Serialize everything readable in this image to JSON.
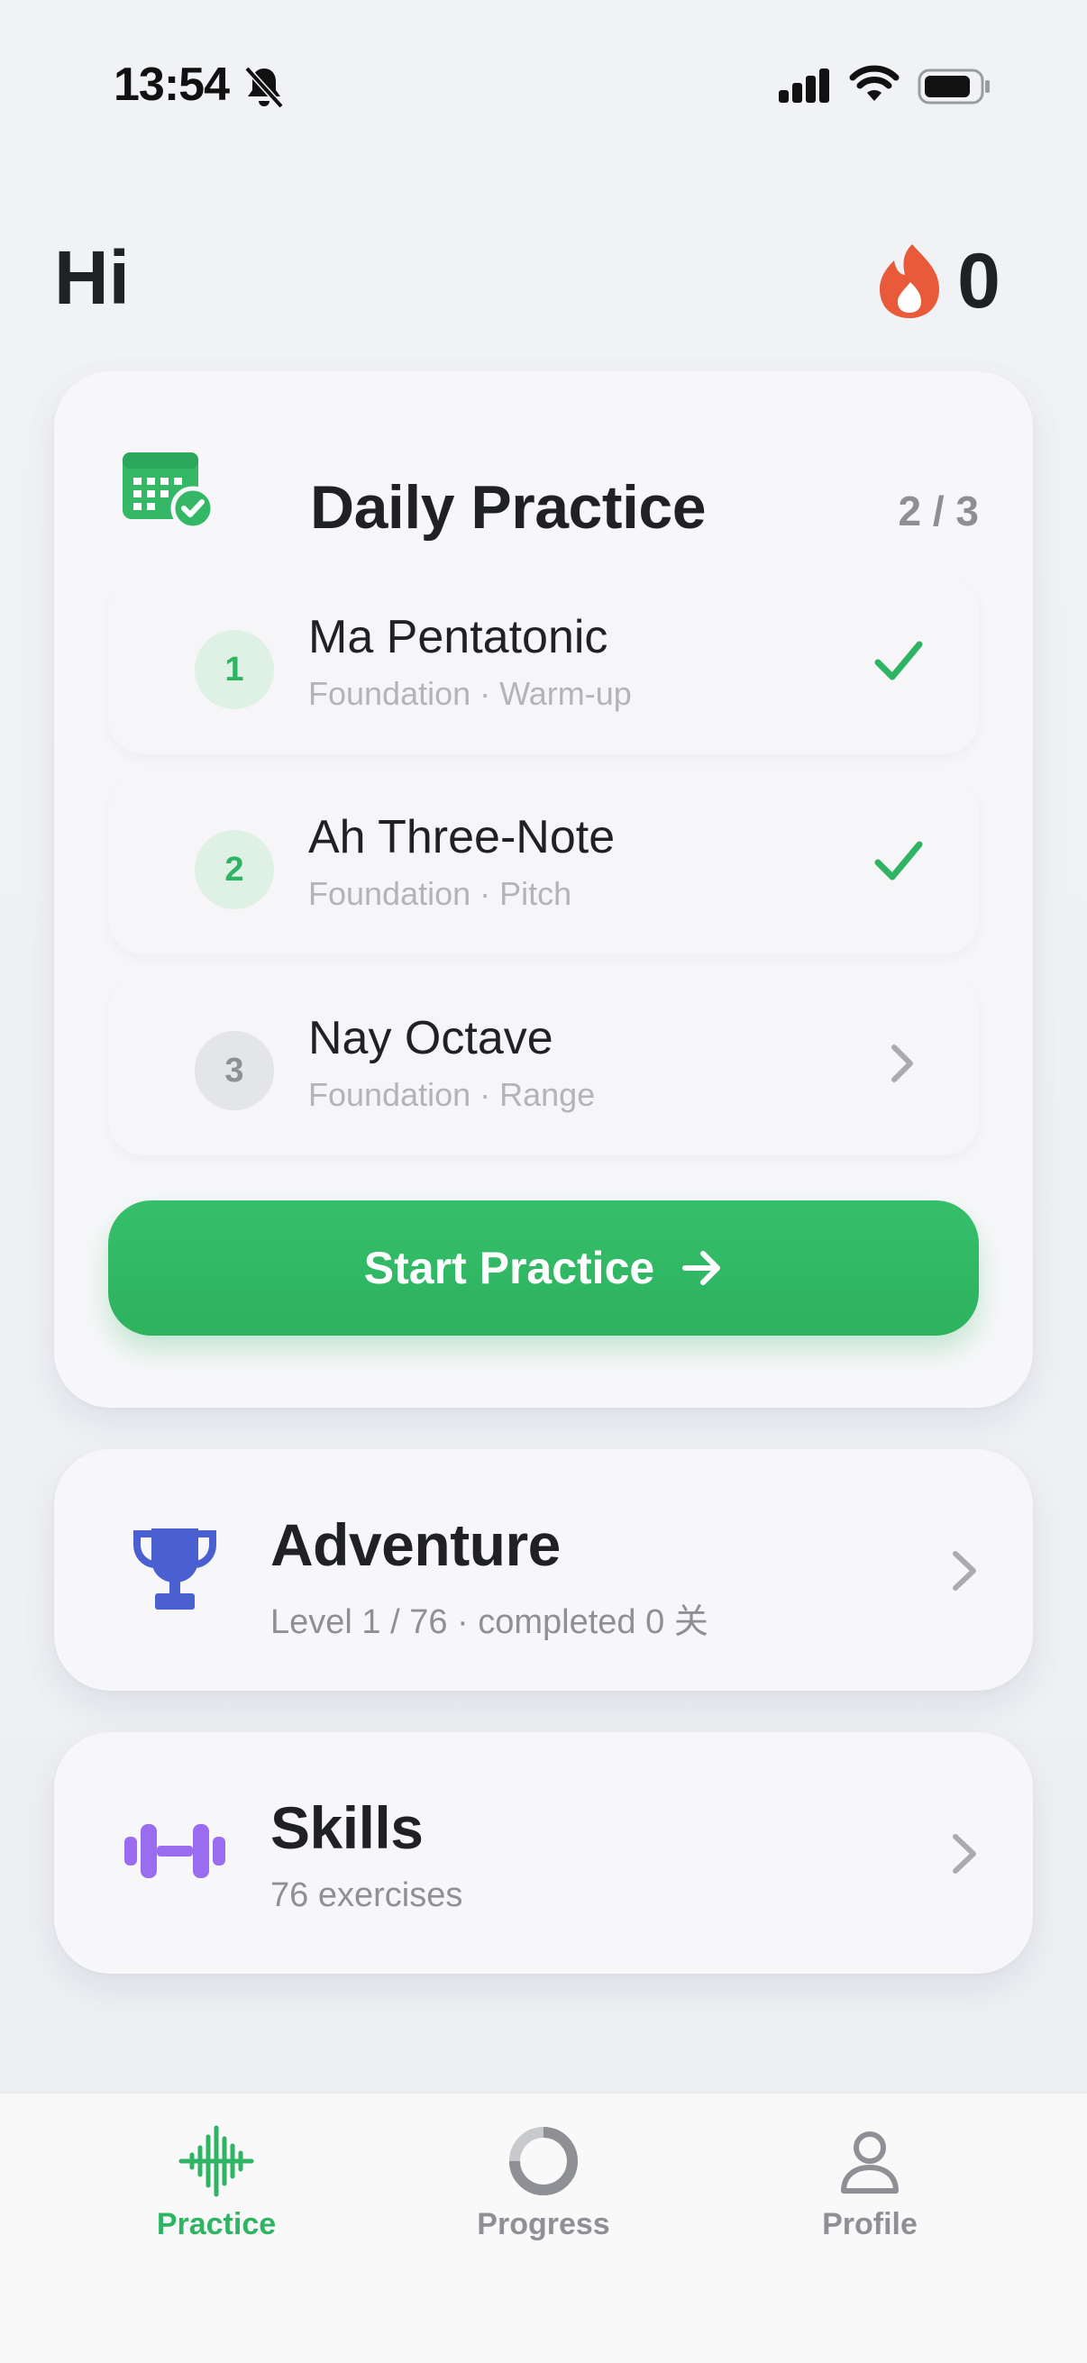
{
  "status_bar": {
    "time": "13:54"
  },
  "header": {
    "greeting": "Hi",
    "streak_count": "0"
  },
  "daily_practice": {
    "title": "Daily Practice",
    "progress": "2 / 3",
    "items": [
      {
        "number": "1",
        "title": "Ma Pentatonic",
        "subtitle": "Foundation · Warm-up",
        "status": "completed"
      },
      {
        "number": "2",
        "title": "Ah Three-Note",
        "subtitle": "Foundation · Pitch",
        "status": "completed"
      },
      {
        "number": "3",
        "title": "Nay Octave",
        "subtitle": "Foundation · Range",
        "status": "pending"
      }
    ],
    "start_button": "Start Practice"
  },
  "adventure": {
    "title": "Adventure",
    "subtitle": "Level 1 / 76 · completed 0 关"
  },
  "skills": {
    "title": "Skills",
    "subtitle": "76 exercises"
  },
  "tabs": [
    {
      "label": "Practice",
      "active": true
    },
    {
      "label": "Progress",
      "active": false
    },
    {
      "label": "Profile",
      "active": false
    }
  ],
  "colors": {
    "accent_green": "#2fb463",
    "flame_orange": "#e85a3a",
    "trophy_blue": "#4a5fd0",
    "skills_purple": "#9a6cf0"
  }
}
